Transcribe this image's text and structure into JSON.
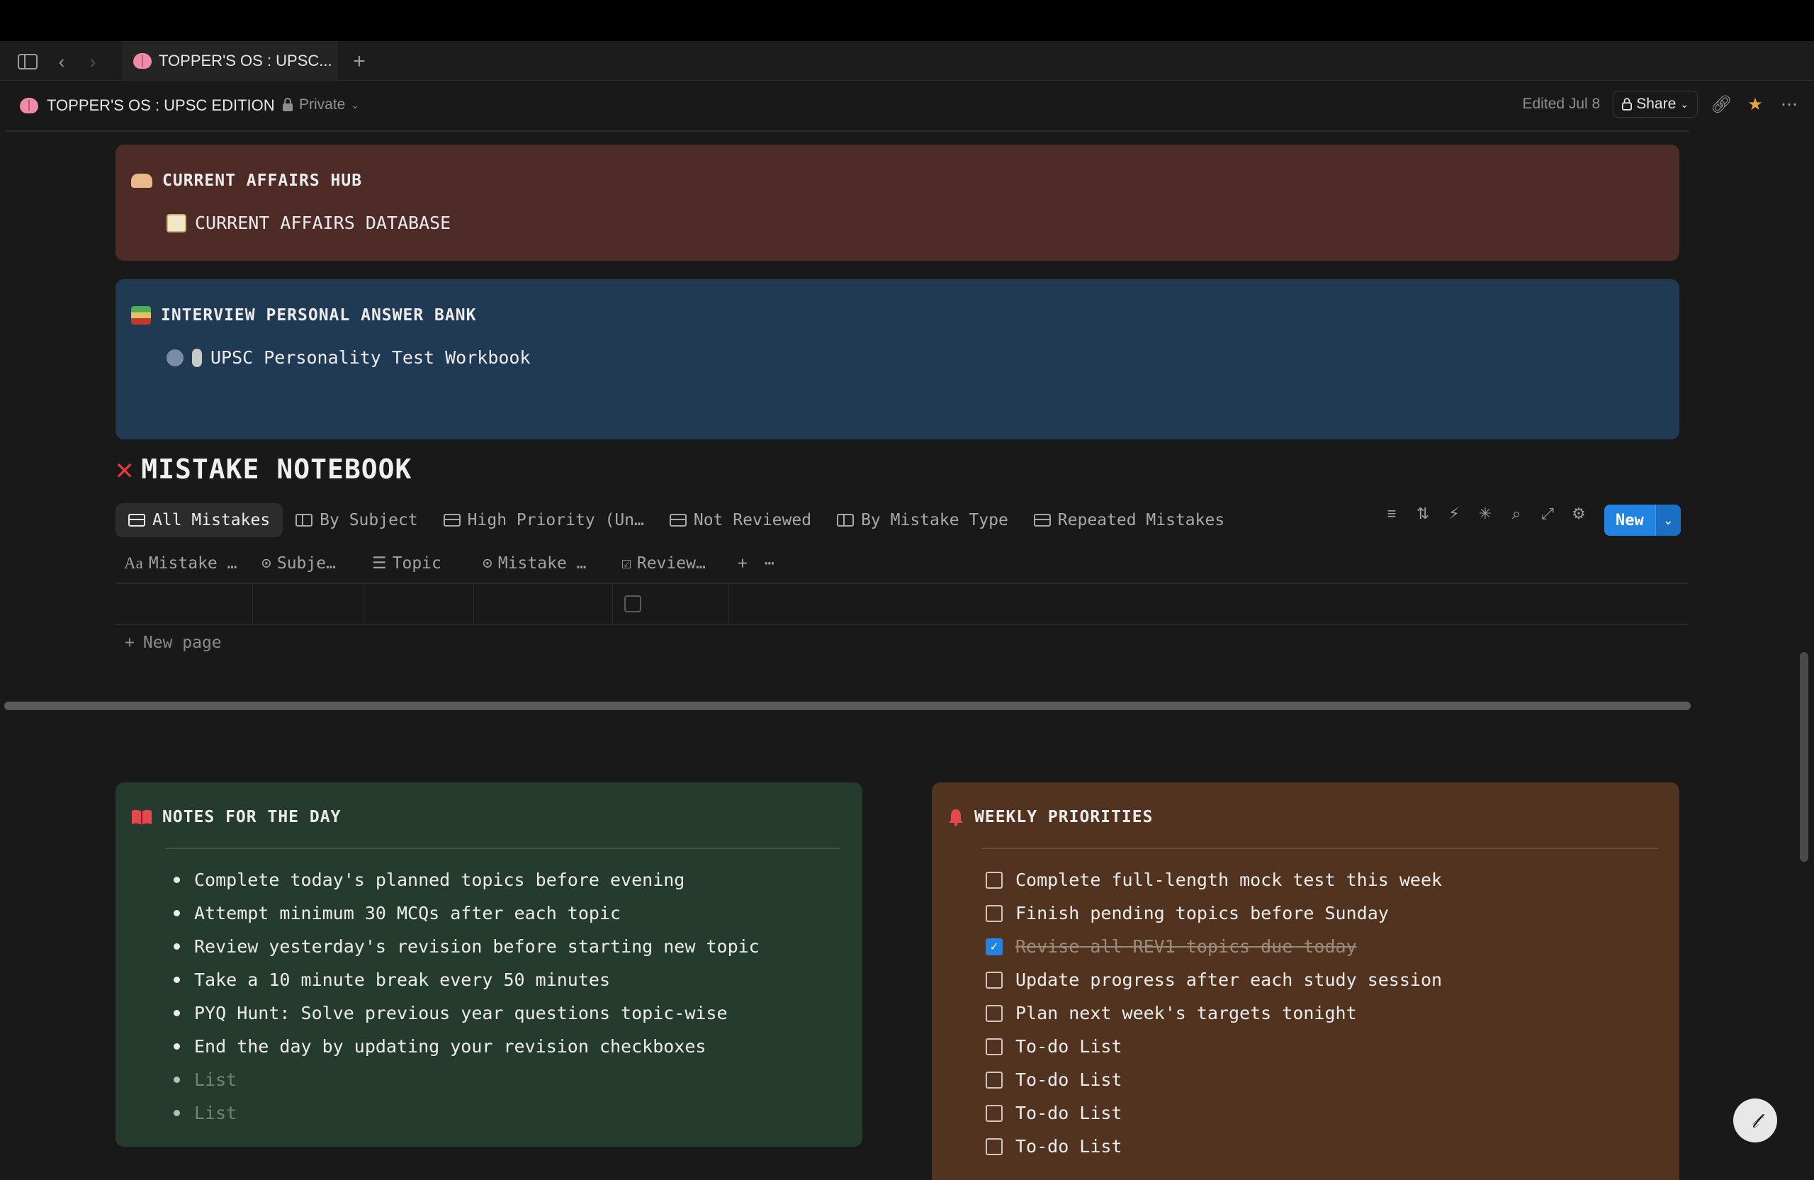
{
  "tab": {
    "title": "TOPPER'S OS : UPSC..."
  },
  "header": {
    "breadcrumb": "TOPPER'S OS : UPSC EDITION",
    "privacy": "Private",
    "edited": "Edited Jul 8",
    "share_label": "Share"
  },
  "current_affairs": {
    "title": "CURRENT AFFAIRS HUB",
    "link": "CURRENT AFFAIRS DATABASE",
    "background": "#4e2b27"
  },
  "interview": {
    "title": "INTERVIEW PERSONAL ANSWER BANK",
    "link": "UPSC Personality Test Workbook",
    "background": "#1f3a52"
  },
  "mistake_notebook": {
    "title": "MISTAKE NOTEBOOK",
    "views": [
      {
        "label": "All Mistakes",
        "icon": "table-icon",
        "active": true
      },
      {
        "label": "By Subject",
        "icon": "board-icon"
      },
      {
        "label": "High Priority (Un…",
        "icon": "table-icon"
      },
      {
        "label": "Not Reviewed",
        "icon": "table-icon"
      },
      {
        "label": "By Mistake Type",
        "icon": "board-icon"
      },
      {
        "label": "Repeated Mistakes",
        "icon": "table-icon"
      }
    ],
    "new_button": "New",
    "columns": [
      {
        "label": "Mistake …",
        "icon": "text-icon"
      },
      {
        "label": "Subje…",
        "icon": "select-icon"
      },
      {
        "label": "Topic",
        "icon": "lines-icon"
      },
      {
        "label": "Mistake …",
        "icon": "select-icon"
      },
      {
        "label": "Review…",
        "icon": "checkbox-icon"
      }
    ],
    "new_page": "New page"
  },
  "notes": {
    "title": "NOTES FOR THE DAY",
    "items": [
      "Complete today's planned topics before evening",
      "Attempt minimum 30 MCQs after each topic",
      "Review yesterday's revision before starting new topic",
      "Take a 10 minute break every 50 minutes",
      "PYQ Hunt: Solve previous year questions topic-wise",
      "End the day by updating your revision checkboxes"
    ],
    "placeholders": [
      "List",
      "List"
    ],
    "background": "#243b2d"
  },
  "weekly": {
    "title": "WEEKLY PRIORITIES",
    "items": [
      {
        "text": "Complete full-length mock test this week",
        "checked": false
      },
      {
        "text": "Finish pending topics before Sunday",
        "checked": false
      },
      {
        "text": "Revise all REV1 topics due today",
        "checked": true
      },
      {
        "text": "Update progress after each study session",
        "checked": false
      },
      {
        "text": "Plan next week's targets tonight",
        "checked": false
      },
      {
        "text": "To-do List",
        "checked": false
      },
      {
        "text": "To-do List",
        "checked": false
      },
      {
        "text": "To-do List",
        "checked": false
      },
      {
        "text": "To-do List",
        "checked": false
      }
    ],
    "background": "#52331f"
  },
  "colors": {
    "accent": "#2383e2",
    "danger": "#e5373a"
  }
}
